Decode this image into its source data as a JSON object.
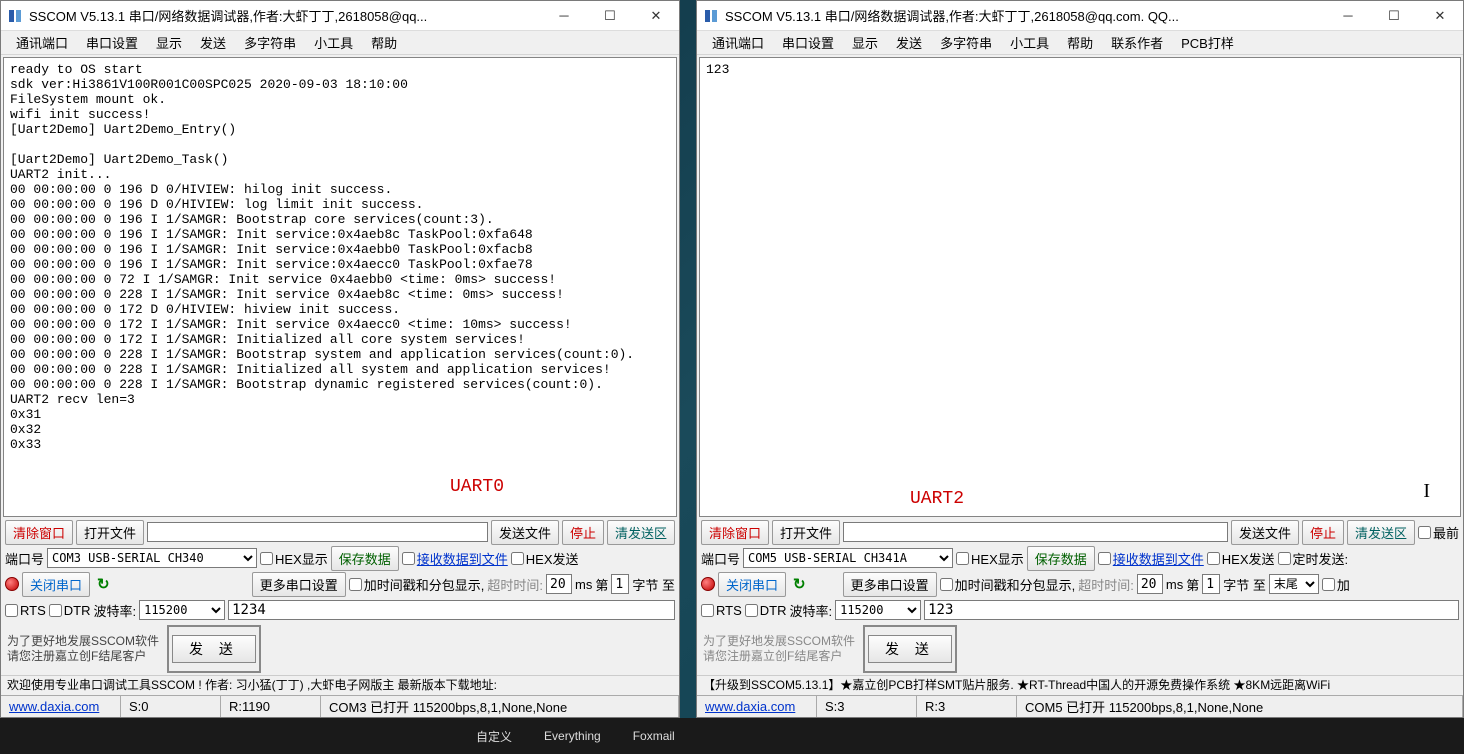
{
  "left": {
    "title": "SSCOM V5.13.1 串口/网络数据调试器,作者:大虾丁丁,2618058@qq...",
    "menus": [
      "通讯端口",
      "串口设置",
      "显示",
      "发送",
      "多字符串",
      "小工具",
      "帮助"
    ],
    "terminal": "ready to OS start\nsdk ver:Hi3861V100R001C00SPC025 2020-09-03 18:10:00\nFileSystem mount ok.\nwifi init success!\n[Uart2Demo] Uart2Demo_Entry()\n\n[Uart2Demo] Uart2Demo_Task()\nUART2 init...\n00 00:00:00 0 196 D 0/HIVIEW: hilog init success.\n00 00:00:00 0 196 D 0/HIVIEW: log limit init success.\n00 00:00:00 0 196 I 1/SAMGR: Bootstrap core services(count:3).\n00 00:00:00 0 196 I 1/SAMGR: Init service:0x4aeb8c TaskPool:0xfa648\n00 00:00:00 0 196 I 1/SAMGR: Init service:0x4aebb0 TaskPool:0xfacb8\n00 00:00:00 0 196 I 1/SAMGR: Init service:0x4aecc0 TaskPool:0xfae78\n00 00:00:00 0 72 I 1/SAMGR: Init service 0x4aebb0 <time: 0ms> success!\n00 00:00:00 0 228 I 1/SAMGR: Init service 0x4aeb8c <time: 0ms> success!\n00 00:00:00 0 172 D 0/HIVIEW: hiview init success.\n00 00:00:00 0 172 I 1/SAMGR: Init service 0x4aecc0 <time: 10ms> success!\n00 00:00:00 0 172 I 1/SAMGR: Initialized all core system services!\n00 00:00:00 0 228 I 1/SAMGR: Bootstrap system and application services(count:0).\n00 00:00:00 0 228 I 1/SAMGR: Initialized all system and application services!\n00 00:00:00 0 228 I 1/SAMGR: Bootstrap dynamic registered services(count:0).\nUART2 recv len=3\n0x31\n0x32\n0x33",
    "uart_label": "UART0",
    "row1": {
      "clear": "清除窗口",
      "open": "打开文件",
      "sendfile": "发送文件",
      "stop": "停止",
      "clearsend": "清发送区"
    },
    "row2": {
      "port_lbl": "端口号",
      "port_val": "COM3 USB-SERIAL CH340",
      "hexshow": "HEX显示",
      "savedata": "保存数据",
      "recvfile": "接收数据到文件",
      "hexsend": "HEX发送"
    },
    "row3": {
      "closecom": "关闭串口",
      "more": "更多串口设置",
      "pkgshow": "加时间戳和分包显示,",
      "timeout": "超时时间:",
      "ms": "20",
      "mslbl": "ms",
      "di": "第",
      "no": "1",
      "bytes": "字节 至"
    },
    "row4": {
      "rts": "RTS",
      "dtr": "DTR",
      "baud_lbl": "波特率:",
      "baud": "115200",
      "send_text": "1234"
    },
    "promo1": "为了更好地发展SSCOM软件",
    "promo2": "请您注册嘉立创F结尾客户",
    "send": "发 送",
    "footer": "欢迎使用专业串口调试工具SSCOM !   作者: 习小猛(丁丁) ,大虾电子网版主   最新版本下载地址:",
    "status": {
      "site": "www.daxia.com",
      "s": "S:0",
      "r": "R:1190",
      "com": "COM3 已打开 115200bps,8,1,None,None"
    }
  },
  "right": {
    "title": "SSCOM V5.13.1 串口/网络数据调试器,作者:大虾丁丁,2618058@qq.com. QQ...",
    "menus": [
      "通讯端口",
      "串口设置",
      "显示",
      "发送",
      "多字符串",
      "小工具",
      "帮助",
      "联系作者",
      "PCB打样"
    ],
    "terminal": "123",
    "uart_label": "UART2",
    "row1": {
      "clear": "清除窗口",
      "open": "打开文件",
      "sendfile": "发送文件",
      "stop": "停止",
      "clearsend": "清发送区",
      "zuiqian": "最前"
    },
    "row2": {
      "port_lbl": "端口号",
      "port_val": "COM5 USB-SERIAL CH341A",
      "hexshow": "HEX显示",
      "savedata": "保存数据",
      "recvfile": "接收数据到文件",
      "hexsend": "HEX发送",
      "dingshi": "定时发送:"
    },
    "row3": {
      "closecom": "关闭串口",
      "more": "更多串口设置",
      "pkgshow": "加时间戳和分包显示,",
      "timeout": "超时时间:",
      "ms": "20",
      "mslbl": "ms",
      "di": "第",
      "no": "1",
      "bytes": "字节 至",
      "mowei": "末尾",
      "jia": "加"
    },
    "row4": {
      "rts": "RTS",
      "dtr": "DTR",
      "baud_lbl": "波特率:",
      "baud": "115200",
      "send_text": "123"
    },
    "promo1": "为了更好地发展SSCOM软件",
    "promo2": "请您注册嘉立创F结尾客户",
    "send": "发 送",
    "footer": "【升级到SSCOM5.13.1】★嘉立创PCB打样SMT贴片服务. ★RT-Thread中国人的开源免费操作系统 ★8KM远距离WiFi",
    "status": {
      "site": "www.daxia.com",
      "s": "S:3",
      "r": "R:3",
      "com": "COM5 已打开 115200bps,8,1,None,None"
    }
  },
  "taskbar": {
    "t1": "自定义",
    "t2": "Everything",
    "t3": "Foxmail"
  }
}
